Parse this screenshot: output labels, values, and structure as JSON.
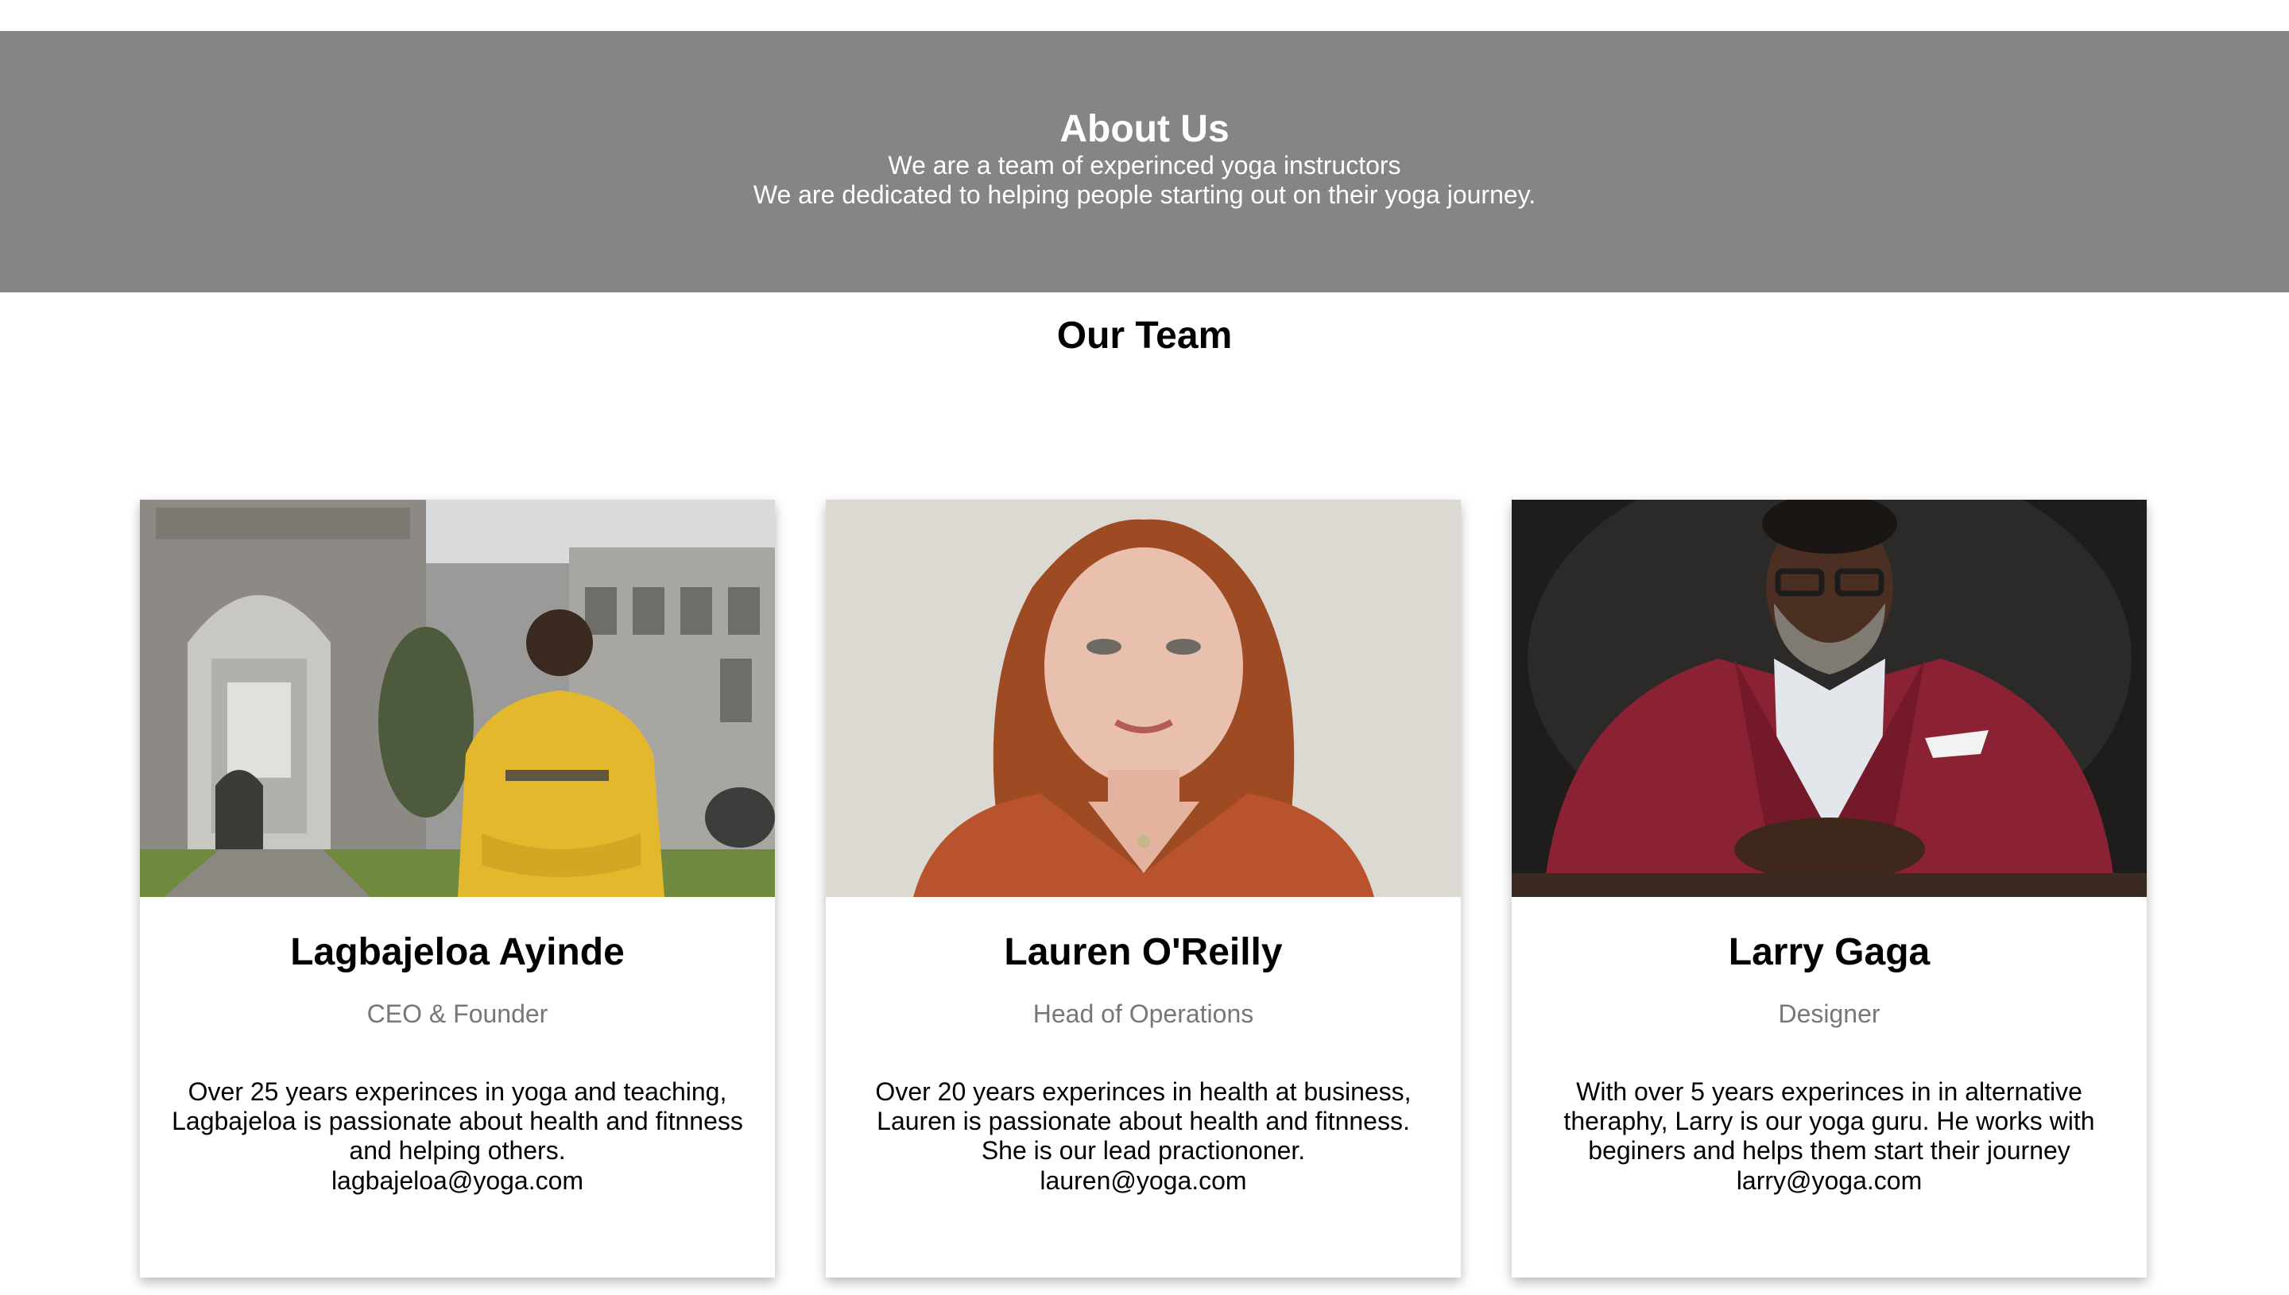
{
  "about": {
    "title": "About Us",
    "line1": "We are a team of experinced yoga instructors",
    "line2": "We are dedicated to helping people starting out on their yoga journey."
  },
  "team": {
    "title": "Our Team",
    "members": [
      {
        "name": "Lagbajeloa Ayinde",
        "role": "CEO & Founder",
        "bio": "Over 25 years experinces in yoga and teaching, Lagbajeloa is passionate about health and fitnness and helping others.",
        "email": "lagbajeloa@yoga.com"
      },
      {
        "name": "Lauren O'Reilly",
        "role": "Head of Operations",
        "bio": "Over 20 years experinces in health at business, Lauren is passionate about health and fitnness. She is our lead practiononer.",
        "email": "lauren@yoga.com"
      },
      {
        "name": "Larry Gaga",
        "role": "Designer",
        "bio": "With over 5 years experinces in in alternative theraphy, Larry is our yoga guru. He works with beginers and helps them start their journey",
        "email": "larry@yoga.com"
      }
    ]
  },
  "colors": {
    "hero_background": "#858585",
    "role_text": "#777777"
  }
}
